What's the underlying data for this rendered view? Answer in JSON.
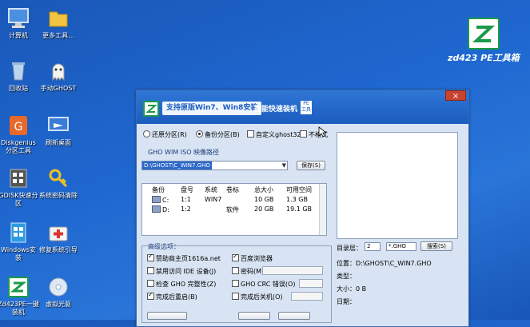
{
  "desktop": {
    "icons": [
      {
        "label": "计算机"
      },
      {
        "label": "更多工具..."
      },
      {
        "label": "回收站"
      },
      {
        "label": "手动GHOST"
      },
      {
        "label": "Diskgenius\n分区工具"
      },
      {
        "label": "刷新桌面"
      },
      {
        "label": "GDISK快速分\n区"
      },
      {
        "label": "系统密码清除"
      },
      {
        "label": "Windows安\n装"
      },
      {
        "label": "修复系统引导"
      },
      {
        "label": "Zd423PE一键\n装机"
      },
      {
        "label": "虚拟光驱"
      }
    ],
    "brand": "zd423 PE工具箱"
  },
  "window": {
    "title_main": "支持原版Win7、Win8安装",
    "title_sub": "智能快速装机",
    "title_pe": "PE\n工具",
    "close": "×",
    "modes": {
      "restore": "还原分区(R)",
      "backup": "备份分区(B)",
      "custom": "自定义ghost32",
      "other": "不格式"
    },
    "path_label": "GHO WIM ISO 映像路径",
    "path_value": "D:\\GHOST\\C_WIN7.GHO",
    "browse": "保存(S)",
    "table": {
      "headers": [
        "备份",
        "盘号",
        "系统",
        "卷标",
        "总大小",
        "可用空间"
      ],
      "rows": [
        [
          "C:",
          "1:1",
          "WIN7",
          "",
          "10 GB",
          "1.3 GB"
        ],
        [
          "D:",
          "1:2",
          "",
          "软件",
          "20 GB",
          "19.1 GB"
        ]
      ]
    },
    "advanced": {
      "label": "高级选项：",
      "items": [
        {
          "text": "赞助商主页1616a.net",
          "checked": true
        },
        {
          "text": "百度浏览器",
          "checked": true
        },
        {
          "text": "禁用访问 IDE 设备(J)",
          "checked": false
        },
        {
          "text": "密码(M)",
          "checked": false
        },
        {
          "text": "检查 GHO 完整性(Z)",
          "checked": false
        },
        {
          "text": "GHO CRC 错误(O)",
          "checked": false
        },
        {
          "text": "完成后重启(B)",
          "checked": true
        },
        {
          "text": "完成后关机(O)",
          "checked": false
        }
      ]
    },
    "right": {
      "dir_label": "目录层：",
      "dir_value": "2",
      "ext_value": "*.GHO",
      "search": "搜索(S)",
      "location": "位置：D:\\GHOST\\C_WIN7.GHO",
      "type": "类型：",
      "size": "大小：0 B",
      "date": "日期："
    }
  }
}
